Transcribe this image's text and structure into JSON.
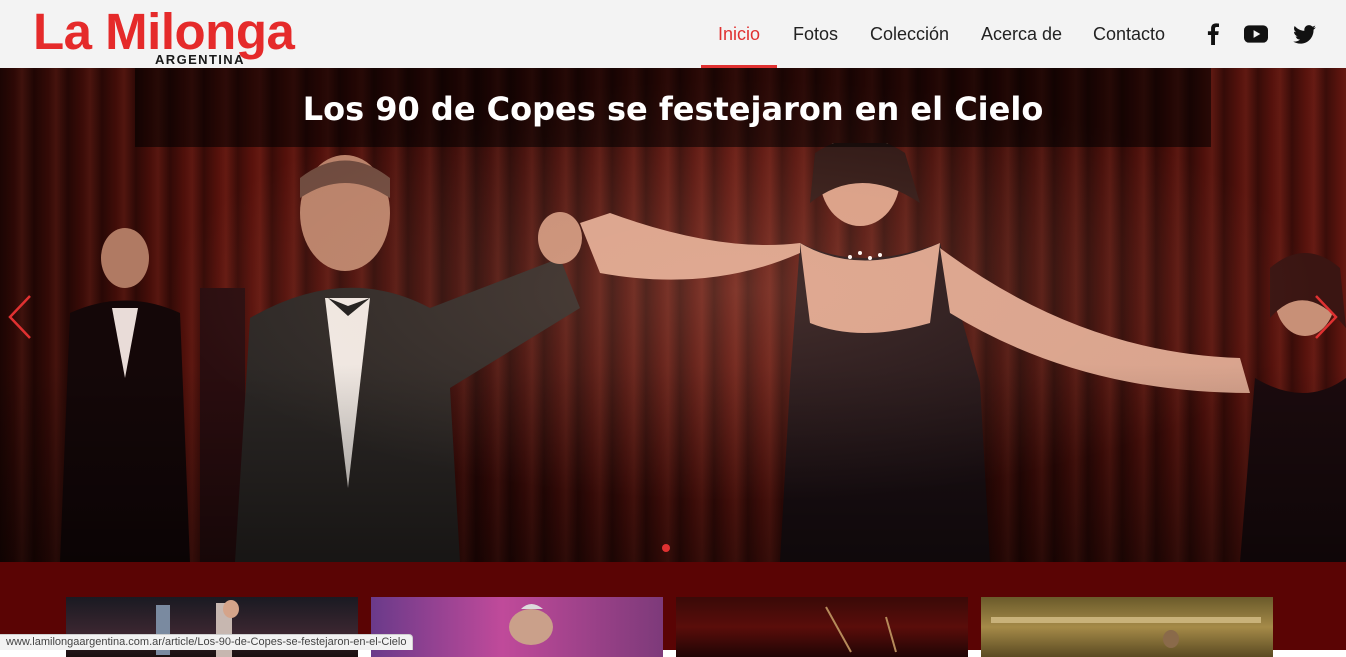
{
  "brand": {
    "name": "La Milonga",
    "subtitle": "ARGENTINA",
    "color": "#e52a2a"
  },
  "nav": {
    "items": [
      {
        "label": "Inicio",
        "active": true
      },
      {
        "label": "Fotos",
        "active": false
      },
      {
        "label": "Colección",
        "active": false
      },
      {
        "label": "Acerca de",
        "active": false
      },
      {
        "label": "Contacto",
        "active": false
      }
    ],
    "accent": "#e03131"
  },
  "social": [
    "facebook-icon",
    "youtube-icon",
    "twitter-icon"
  ],
  "slider": {
    "title": "Los 90 de Copes se festejaron en el Cielo",
    "slide_count": 1,
    "active_slide": 1
  },
  "thumbnails": [
    "thumbnail-1",
    "thumbnail-2",
    "thumbnail-3",
    "thumbnail-4"
  ],
  "status_url": "www.lamilongaargentina.com.ar/article/Los-90-de-Copes-se-festejaron-en-el-Cielo"
}
